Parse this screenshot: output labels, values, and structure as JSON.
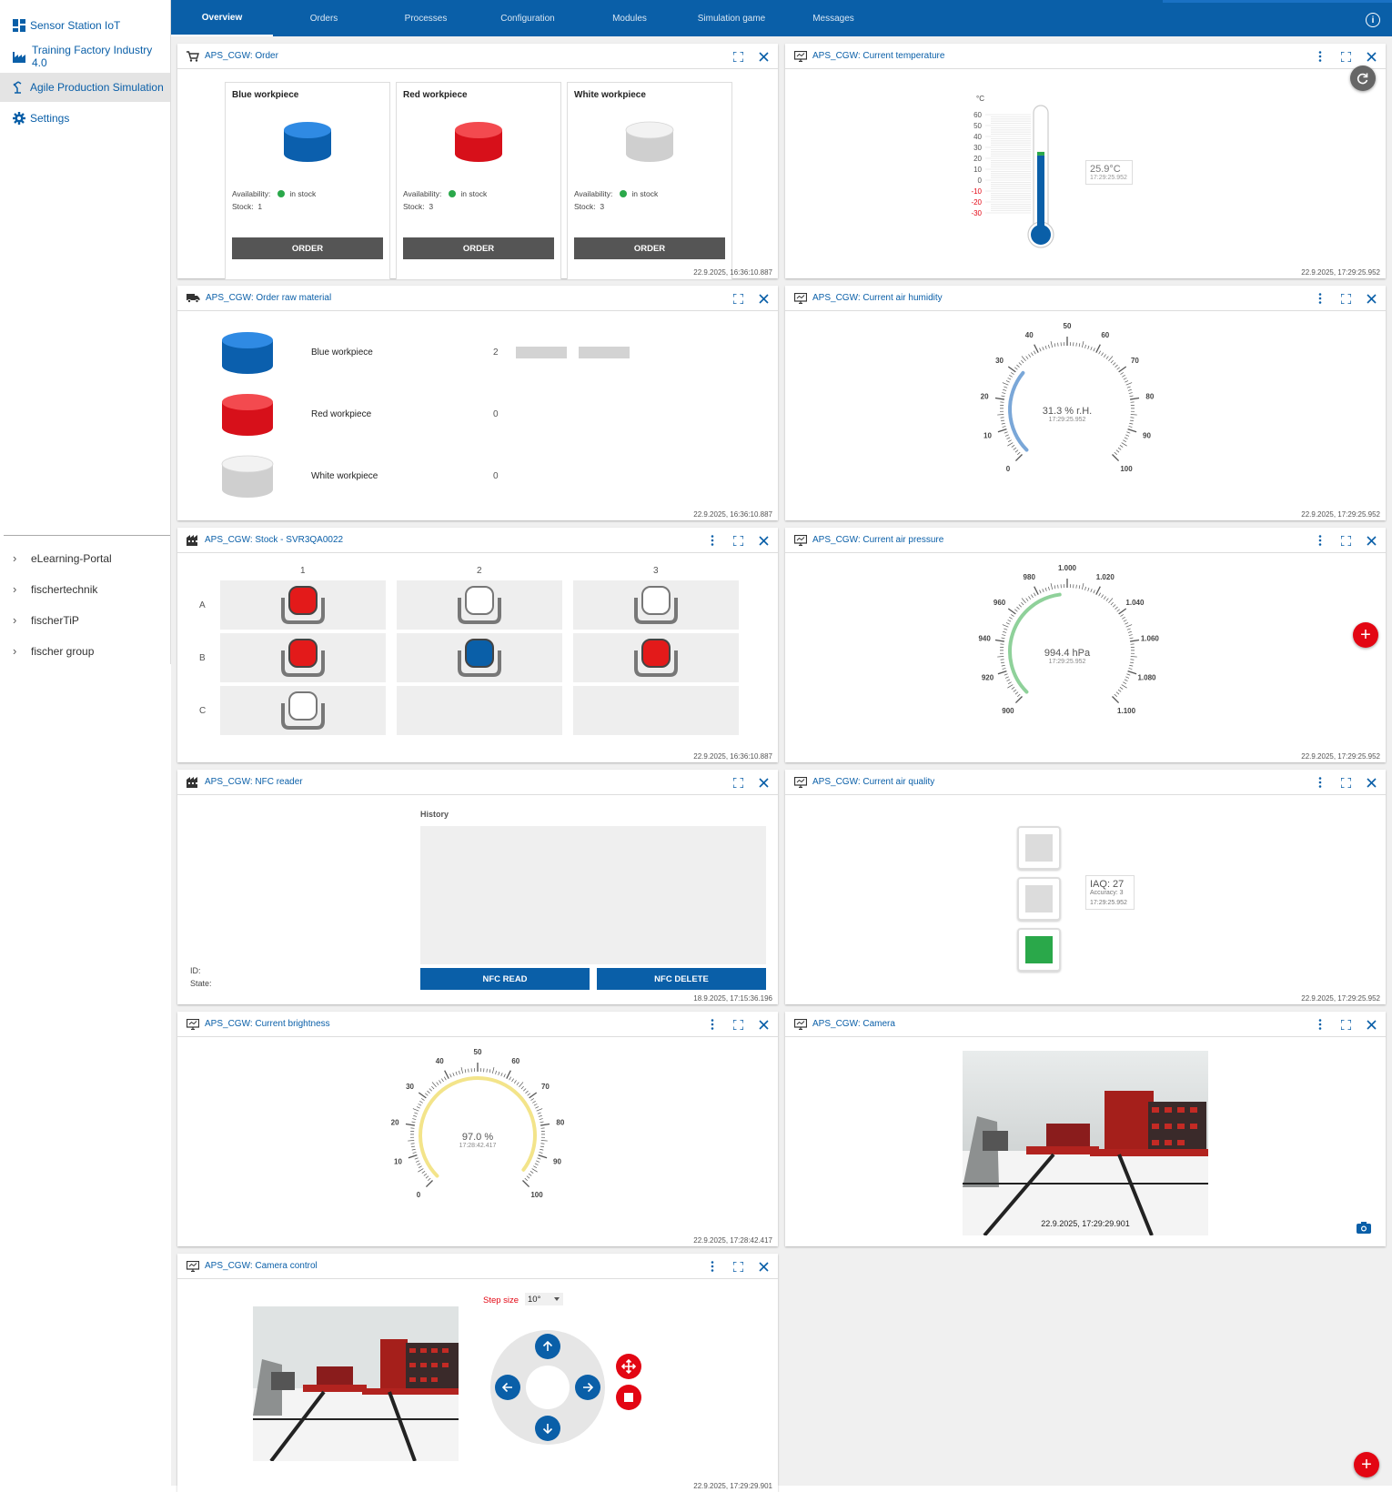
{
  "sidebar": {
    "items": [
      {
        "label": "Sensor Station IoT",
        "icon": "dashboard-icon"
      },
      {
        "label": "Training Factory Industry 4.0",
        "icon": "factory-icon"
      },
      {
        "label": "Agile Production Simulation",
        "icon": "robot-arm-icon"
      },
      {
        "label": "Settings",
        "icon": "gear-icon"
      }
    ],
    "links": [
      "eLearning-Portal",
      "fischertechnik",
      "fischerTiP",
      "fischer group"
    ]
  },
  "tabs": [
    "Overview",
    "Orders",
    "Processes",
    "Configuration",
    "Modules",
    "Simulation game",
    "Messages"
  ],
  "active_tab": "Overview",
  "colors": {
    "brand": "#0a5fa8",
    "red": "#e30613",
    "green": "#2aa84a"
  },
  "order": {
    "title": "APS_CGW: Order",
    "availability_label": "Availability:",
    "stock_label": "Stock:",
    "button": "ORDER",
    "cards": [
      {
        "name": "Blue workpiece",
        "availability": "in stock",
        "stock": "1"
      },
      {
        "name": "Red workpiece",
        "availability": "in stock",
        "stock": "3"
      },
      {
        "name": "White workpiece",
        "availability": "in stock",
        "stock": "3"
      }
    ],
    "timestamp": "22.9.2025, 16:36:10.887"
  },
  "raw": {
    "title": "APS_CGW: Order raw material",
    "items": [
      {
        "name": "Blue workpiece",
        "count": "2"
      },
      {
        "name": "Red workpiece",
        "count": "0"
      },
      {
        "name": "White workpiece",
        "count": "0"
      }
    ],
    "timestamp": "22.9.2025, 16:36:10.887"
  },
  "stock": {
    "title": "APS_CGW: Stock - SVR3QA0022",
    "cols": [
      "1",
      "2",
      "3"
    ],
    "rows": [
      "A",
      "B",
      "C"
    ],
    "grid": [
      [
        "red",
        "white",
        "white"
      ],
      [
        "red",
        "blue",
        "red"
      ],
      [
        "white",
        "empty",
        "empty"
      ]
    ],
    "timestamp": "22.9.2025, 16:36:10.887"
  },
  "nfc": {
    "title": "APS_CGW: NFC reader",
    "history": "History",
    "id_label": "ID:",
    "state_label": "State:",
    "read": "NFC READ",
    "delete": "NFC DELETE",
    "timestamp": "18.9.2025, 17:15:36.196"
  },
  "brightness": {
    "title": "APS_CGW: Current brightness",
    "value_text": "97.0 %",
    "value": 97.0,
    "time": "17:28:42.417",
    "ticks": [
      "0",
      "10",
      "20",
      "30",
      "40",
      "50",
      "60",
      "70",
      "80",
      "90",
      "100"
    ],
    "timestamp": "22.9.2025, 17:28:42.417"
  },
  "camctl": {
    "title": "APS_CGW: Camera control",
    "step_label": "Step size",
    "step_value": "10°",
    "timestamp": "22.9.2025, 17:29:29.901"
  },
  "temp": {
    "title": "APS_CGW: Current temperature",
    "unit": "°C",
    "ticks": [
      "60",
      "50",
      "40",
      "30",
      "20",
      "10",
      "0",
      "-10",
      "-20",
      "-30"
    ],
    "value_text": "25.9°C",
    "value": 25.9,
    "time": "17:29:25.952",
    "timestamp": "22.9.2025, 17:29:25.952"
  },
  "humidity": {
    "title": "APS_CGW: Current air humidity",
    "value_text": "31.3 % r.H.",
    "value": 31.3,
    "time": "17:29:25.952",
    "ticks": [
      "0",
      "10",
      "20",
      "30",
      "40",
      "50",
      "60",
      "70",
      "80",
      "90",
      "100"
    ],
    "timestamp": "22.9.2025, 17:29:25.952"
  },
  "pressure": {
    "title": "APS_CGW: Current air pressure",
    "value_text": "994.4 hPa",
    "value": 994.4,
    "time": "17:29:25.952",
    "ticks": [
      "900",
      "920",
      "940",
      "960",
      "980",
      "1.000",
      "1.020",
      "1.040",
      "1.060",
      "1.080",
      "1.100"
    ],
    "timestamp": "22.9.2025, 17:29:25.952"
  },
  "quality": {
    "title": "APS_CGW: Current air quality",
    "iaq": "IAQ: 27",
    "accuracy": "Accuracy: 3",
    "time": "17:29:25.952",
    "timestamp": "22.9.2025, 17:29:25.952"
  },
  "camera": {
    "title": "APS_CGW: Camera",
    "overlay": "22.9.2025, 17:29:29.901"
  }
}
